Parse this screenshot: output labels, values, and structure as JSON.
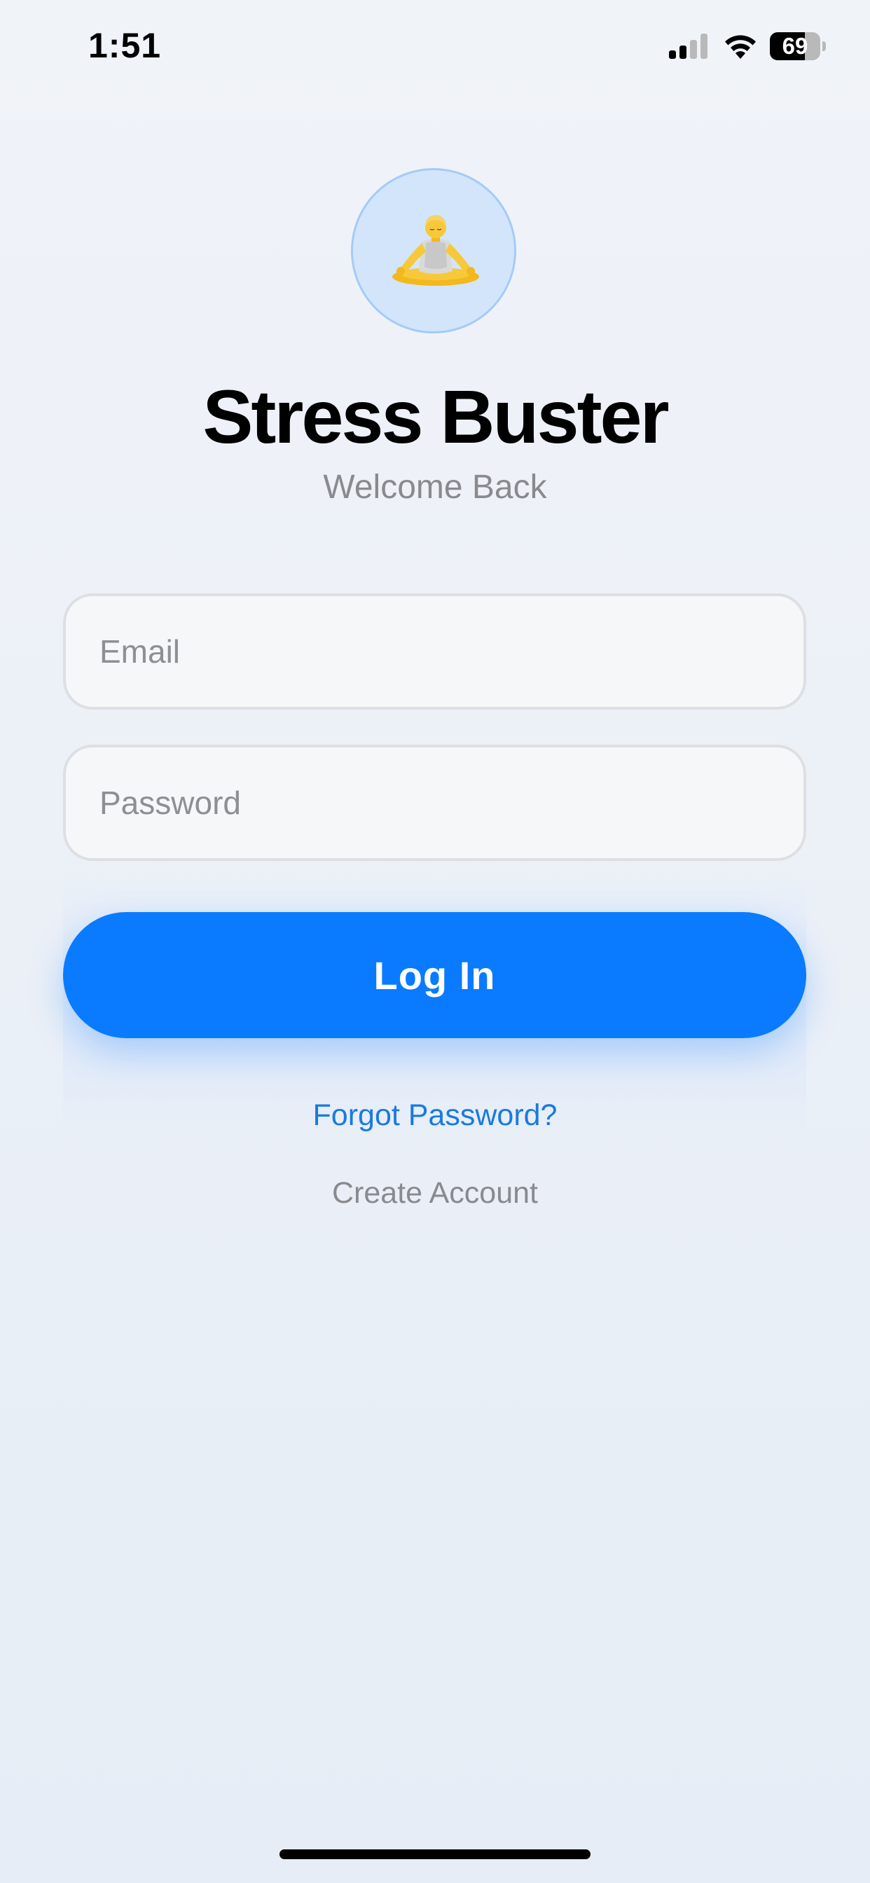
{
  "status_bar": {
    "time": "1:51",
    "battery_level": "69",
    "battery_fraction": 0.69,
    "icons": [
      "cellular-signal-icon",
      "wifi-icon",
      "battery-icon"
    ]
  },
  "logo": {
    "icon": "person-meditating-icon",
    "colors": {
      "circle_fill": "#d3e5fb",
      "circle_border": "#a4cbf7"
    }
  },
  "header": {
    "title": "Stress Buster",
    "subtitle": "Welcome Back"
  },
  "form": {
    "email": {
      "placeholder": "Email",
      "value": ""
    },
    "password": {
      "placeholder": "Password",
      "value": ""
    },
    "login_label": "Log In",
    "forgot_label": "Forgot Password?",
    "create_label": "Create Account"
  },
  "colors": {
    "accent": "#0a7bff",
    "link": "#1a7ae0",
    "secondary_text": "#8a8a8e"
  }
}
